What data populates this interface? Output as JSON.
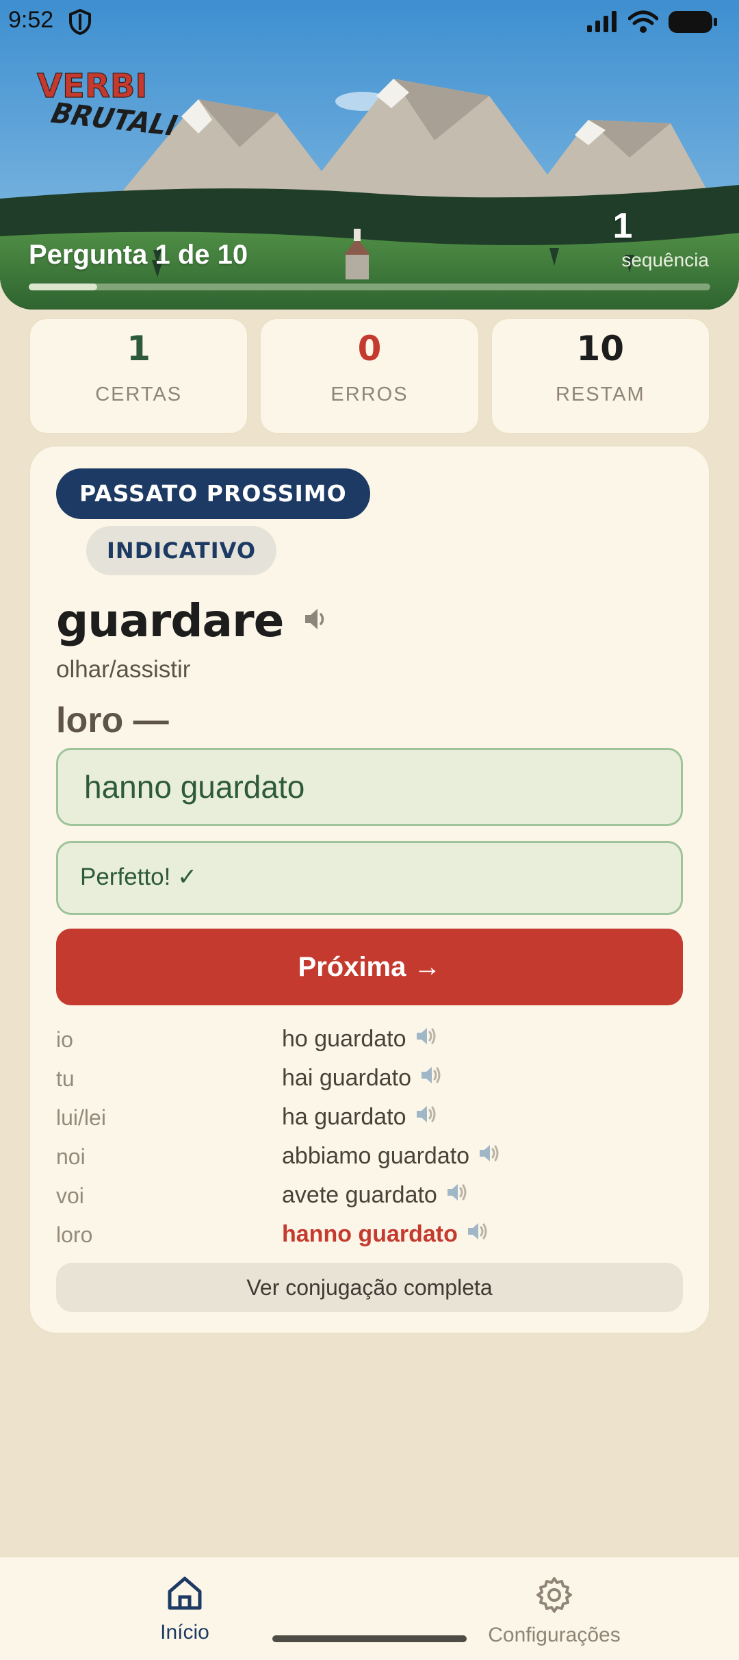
{
  "status_bar": {
    "time": "9:52"
  },
  "header": {
    "logo": {
      "line1": "VERBI",
      "line2": "BRUTALI"
    },
    "question_label": "Pergunta 1 de 10",
    "streak": {
      "value": "1",
      "label": "sequência"
    },
    "progress": 0.1
  },
  "stats": [
    {
      "value": "1",
      "label": "CERTAS",
      "color": "#2d5a3a"
    },
    {
      "value": "0",
      "label": "ERROS",
      "color": "#c43a2e"
    },
    {
      "value": "10",
      "label": "RESTAM",
      "color": "#1d1d1d"
    }
  ],
  "exercise": {
    "tense": "PASSATO PROSSIMO",
    "mood": "INDICATIVO",
    "verb": "guardare",
    "translation": "olhar/assistir",
    "pronoun_prompt": "loro —",
    "answer_value": "hanno guardato",
    "feedback": "Perfetto! ✓",
    "next_button": "Próxima →",
    "conjugation": [
      {
        "pronoun": "io",
        "form": "ho guardato",
        "highlight": false
      },
      {
        "pronoun": "tu",
        "form": "hai guardato",
        "highlight": false
      },
      {
        "pronoun": "lui/lei",
        "form": "ha guardato",
        "highlight": false
      },
      {
        "pronoun": "noi",
        "form": "abbiamo guardato",
        "highlight": false
      },
      {
        "pronoun": "voi",
        "form": "avete guardato",
        "highlight": false
      },
      {
        "pronoun": "loro",
        "form": "hanno guardato",
        "highlight": true
      }
    ],
    "full_conjugation_button": "Ver conjugação completa"
  },
  "nav": {
    "items": [
      {
        "label": "Início",
        "icon": "home-icon",
        "active": true
      },
      {
        "label": "Configurações",
        "icon": "gear-icon",
        "active": false
      }
    ]
  },
  "colors": {
    "accent_red": "#c43a2e",
    "navy": "#1c3a63",
    "green": "#2d5a3a",
    "background": "#ede3cc"
  }
}
